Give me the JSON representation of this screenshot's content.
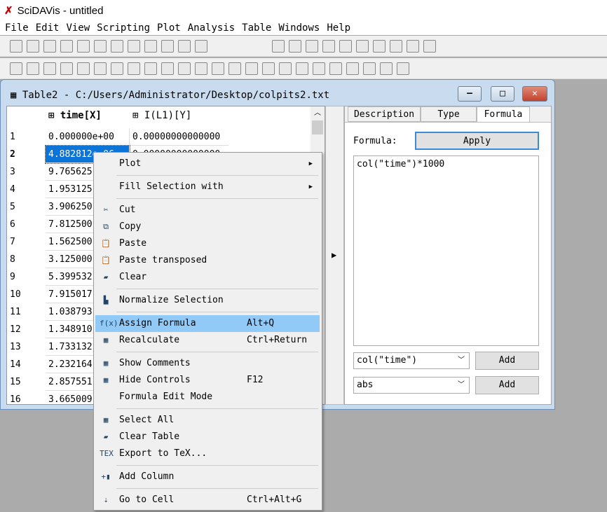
{
  "app": {
    "title": "SciDAVis - untitled"
  },
  "menubar": [
    "File",
    "Edit",
    "View",
    "Scripting",
    "Plot",
    "Analysis",
    "Table",
    "Windows",
    "Help"
  ],
  "window": {
    "title": "Table2 - C:/Users/Administrator/Desktop/colpits2.txt"
  },
  "table": {
    "columns": [
      "time[X]",
      "I(L1)[Y]"
    ],
    "rows": [
      {
        "n": "1",
        "time": "0.000000e+00",
        "i": "0.00000000000000"
      },
      {
        "n": "2",
        "time": "4.882812e-06",
        "i": "0.00000000000000"
      },
      {
        "n": "3",
        "time": "9.765625"
      },
      {
        "n": "4",
        "time": "1.953125"
      },
      {
        "n": "5",
        "time": "3.906250"
      },
      {
        "n": "6",
        "time": "7.812500"
      },
      {
        "n": "7",
        "time": "1.562500"
      },
      {
        "n": "8",
        "time": "3.125000"
      },
      {
        "n": "9",
        "time": "5.399532"
      },
      {
        "n": "10",
        "time": "7.915017"
      },
      {
        "n": "11",
        "time": "1.038793"
      },
      {
        "n": "12",
        "time": "1.348910"
      },
      {
        "n": "13",
        "time": "1.733132"
      },
      {
        "n": "14",
        "time": "2.232164"
      },
      {
        "n": "15",
        "time": "2.857551"
      },
      {
        "n": "16",
        "time": "3.665009"
      }
    ]
  },
  "panel": {
    "tabs": [
      "Description",
      "Type",
      "Formula"
    ],
    "formula_label": "Formula:",
    "apply": "Apply",
    "formula": "col(\"time\")*1000",
    "combo1": "col(\"time\")",
    "combo2": "abs",
    "add": "Add"
  },
  "context_menu": [
    {
      "label": "Plot",
      "submenu": true
    },
    {
      "label": "Fill Selection with",
      "submenu": true
    },
    {
      "label": "Cut",
      "icon": "scissors-icon"
    },
    {
      "label": "Copy",
      "icon": "copy-icon"
    },
    {
      "label": "Paste",
      "icon": "paste-icon"
    },
    {
      "label": "Paste transposed",
      "icon": "paste-icon"
    },
    {
      "label": "Clear",
      "icon": "eraser-icon"
    },
    {
      "label": "Normalize Selection",
      "icon": "histogram-icon"
    },
    {
      "label": "Assign Formula",
      "shortcut": "Alt+Q",
      "icon": "f(x)",
      "highlighted": true
    },
    {
      "label": "Recalculate",
      "shortcut": "Ctrl+Return",
      "icon": "calculator-icon"
    },
    {
      "label": "Show Comments",
      "icon": "table-icon"
    },
    {
      "label": "Hide Controls",
      "shortcut": "F12",
      "icon": "table-icon"
    },
    {
      "label": "Formula Edit Mode"
    },
    {
      "label": "Select All",
      "icon": "table-icon"
    },
    {
      "label": "Clear Table",
      "icon": "eraser-icon"
    },
    {
      "label": "Export to TeX...",
      "icon": "TeX"
    },
    {
      "label": "Add Column",
      "icon": "add-column-icon"
    },
    {
      "label": "Go to Cell",
      "shortcut": "Ctrl+Alt+G",
      "icon": "goto-icon"
    }
  ]
}
